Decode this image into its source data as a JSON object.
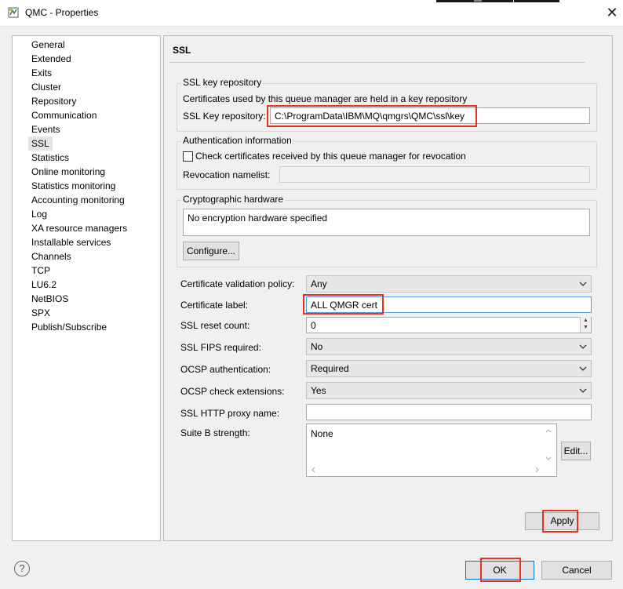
{
  "window": {
    "title": "QMC - Properties",
    "close_glyph": "✕"
  },
  "nav": {
    "items": [
      {
        "label": "General"
      },
      {
        "label": "Extended"
      },
      {
        "label": "Exits"
      },
      {
        "label": "Cluster"
      },
      {
        "label": "Repository"
      },
      {
        "label": "Communication"
      },
      {
        "label": "Events"
      },
      {
        "label": "SSL",
        "selected": true
      },
      {
        "label": "Statistics"
      },
      {
        "label": "Online monitoring"
      },
      {
        "label": "Statistics monitoring"
      },
      {
        "label": "Accounting monitoring"
      },
      {
        "label": "Log"
      },
      {
        "label": "XA resource managers"
      },
      {
        "label": "Installable services"
      },
      {
        "label": "Channels"
      },
      {
        "label": "TCP"
      },
      {
        "label": "LU6.2"
      },
      {
        "label": "NetBIOS"
      },
      {
        "label": "SPX"
      },
      {
        "label": "Publish/Subscribe"
      }
    ]
  },
  "ssl": {
    "section_title": "SSL",
    "key_repo": {
      "group_label": "SSL key repository",
      "description": "Certificates used by this queue manager are held in a key repository",
      "field_label": "SSL Key repository:",
      "value": "C:\\ProgramData\\IBM\\MQ\\qmgrs\\QMC\\ssl\\key"
    },
    "auth": {
      "group_label": "Authentication information",
      "check_label": "Check certificates received by this queue manager for revocation",
      "checked": false,
      "namelist_label": "Revocation namelist:",
      "namelist_value": ""
    },
    "crypto": {
      "group_label": "Cryptographic hardware",
      "value": "No encryption hardware specified",
      "configure_button": "Configure..."
    },
    "fields": {
      "cert_validation_policy": {
        "label": "Certificate validation policy:",
        "value": "Any"
      },
      "cert_label": {
        "label": "Certificate label:",
        "value": "ALL QMGR cert"
      },
      "reset_count": {
        "label": "SSL reset count:",
        "value": "0"
      },
      "fips": {
        "label": "SSL FIPS required:",
        "value": "No"
      },
      "ocsp_auth": {
        "label": "OCSP authentication:",
        "value": "Required"
      },
      "ocsp_ext": {
        "label": "OCSP check extensions:",
        "value": "Yes"
      },
      "http_proxy": {
        "label": "SSL HTTP proxy name:",
        "value": ""
      },
      "suite_b": {
        "label": "Suite B strength:",
        "value": "None",
        "edit_button": "Edit..."
      }
    },
    "apply_button": "Apply"
  },
  "footer": {
    "help_glyph": "?",
    "ok_button": "OK",
    "cancel_button": "Cancel"
  },
  "colors": {
    "highlight_box": "#e8321e",
    "dialog_bg": "#f0f0f0"
  },
  "icons": [
    "app-icon",
    "close-icon",
    "help-icon",
    "chevron-down-icon",
    "spinner-up-icon",
    "spinner-down-icon"
  ]
}
